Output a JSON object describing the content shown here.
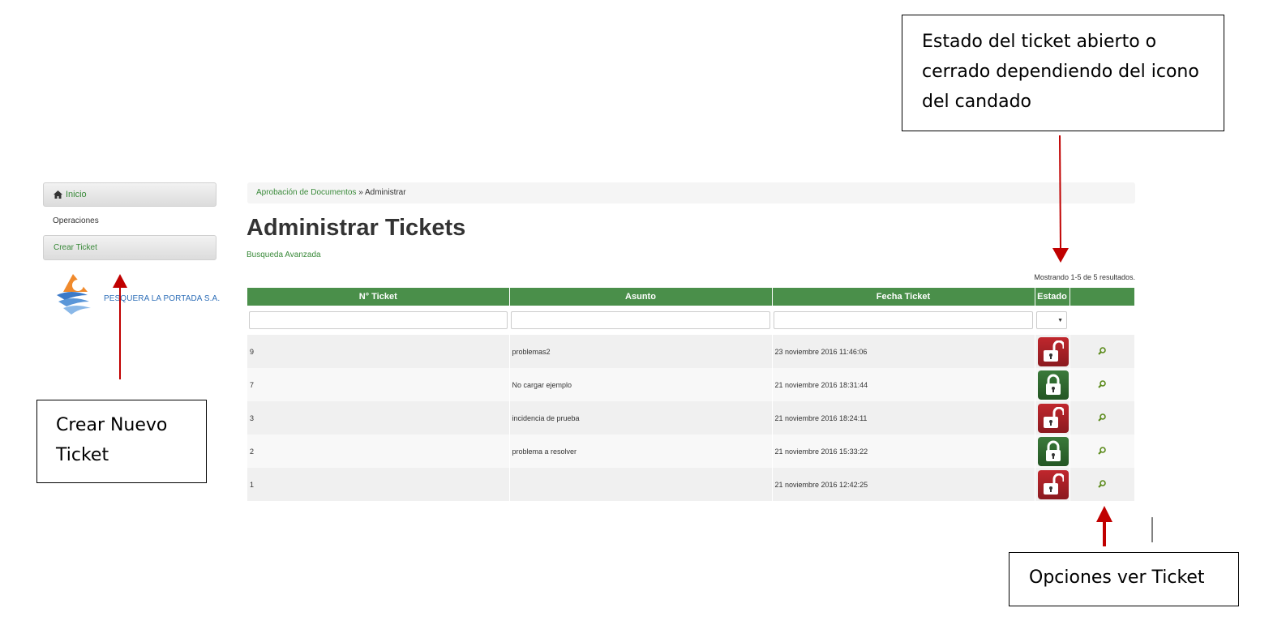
{
  "sidebar": {
    "inicio_label": "Inicio",
    "operaciones_label": "Operaciones",
    "crear_ticket_label": "Crear Ticket",
    "logo_text": "PESQUERA LA PORTADA S.A."
  },
  "breadcrumb": {
    "link": "Aprobación de Documentos",
    "separator": " » ",
    "current": "Administrar"
  },
  "page": {
    "title": "Administrar Tickets",
    "advanced_search": "Busqueda Avanzada",
    "summary": "Mostrando 1-5 de 5 resultados."
  },
  "table": {
    "headers": [
      "N° Ticket",
      "Asunto",
      "Fecha Ticket",
      "Estado",
      ""
    ],
    "rows": [
      {
        "id": "9",
        "asunto": "problemas2",
        "fecha": "23 noviembre 2016 11:46:06",
        "estado": "open"
      },
      {
        "id": "7",
        "asunto": "No cargar ejemplo",
        "fecha": "21 noviembre 2016 18:31:44",
        "estado": "closed"
      },
      {
        "id": "3",
        "asunto": "incidencia de prueba",
        "fecha": "21 noviembre 2016 18:24:11",
        "estado": "open"
      },
      {
        "id": "2",
        "asunto": "problema a resolver",
        "fecha": "21 noviembre 2016 15:33:22",
        "estado": "closed"
      },
      {
        "id": "1",
        "asunto": "",
        "fecha": "21 noviembre 2016 12:42:25",
        "estado": "open"
      }
    ]
  },
  "annotations": {
    "estado": "Estado del ticket abierto o cerrado dependiendo del icono del candado",
    "crear": "Crear Nuevo Ticket",
    "opciones": "Opciones ver Ticket"
  },
  "colors": {
    "header_green": "#4a8f4a",
    "link_green": "#3a8a3a",
    "lock_open_red": "#c0272d",
    "lock_closed_green": "#3a7a3a",
    "arrow_red": "#c00000"
  }
}
